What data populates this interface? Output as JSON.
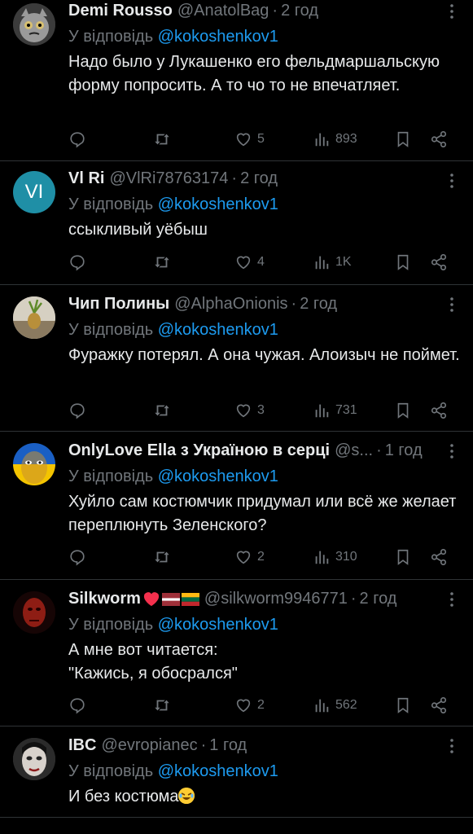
{
  "reply_prefix": "У відповідь",
  "icons": {
    "reply": "comment-icon",
    "retweet": "retweet-icon",
    "like": "heart-icon",
    "views": "views-icon",
    "bookmark": "bookmark-icon",
    "share": "share-icon",
    "more": "more-icon"
  },
  "colors": {
    "accent": "#1d9bf0",
    "muted": "#71767b",
    "text": "#e7e9ea",
    "divider": "#2f3336"
  },
  "tweets": [
    {
      "name": "Demi Rousso",
      "handle": "@AnatolBag",
      "time": "2 год",
      "mention": "@kokoshenkov1",
      "text": "Надо было у Лукашенко его фельдмаршальскую форму попросить. А то чо то не впечатляет.",
      "likes": "5",
      "views": "893"
    },
    {
      "name": "Vl Ri",
      "handle": "@VlRi78763174",
      "time": "2 год",
      "mention": "@kokoshenkov1",
      "text": "ссыкливый уёбыш",
      "likes": "4",
      "views": "1K",
      "avatar_initials": "VI"
    },
    {
      "name": "Чип Полины",
      "handle": "@AlphaOnionis",
      "time": "2 год",
      "mention": "@kokoshenkov1",
      "text": "Фуражку потерял. А она чужая. Алоизыч не поймет.",
      "likes": "3",
      "views": "731"
    },
    {
      "name": "OnlyLove Ella з Україною в серці",
      "handle": "@s...",
      "time": "1 год",
      "mention": "@kokoshenkov1",
      "text": "Хуйло сам костюмчик придумал или всё же желает переплюнуть Зеленского?",
      "likes": "2",
      "views": "310"
    },
    {
      "name": "Silkworm",
      "handle": "@silkworm9946771",
      "time": "2 год",
      "mention": "@kokoshenkov1",
      "text": "А мне вот читается:\n\"Кажись, я обосрался\"",
      "likes": "2",
      "views": "562"
    },
    {
      "name": "IBC",
      "handle": "@evropianec",
      "time": "1 год",
      "mention": "@kokoshenkov1",
      "text": "И без костюма"
    }
  ]
}
